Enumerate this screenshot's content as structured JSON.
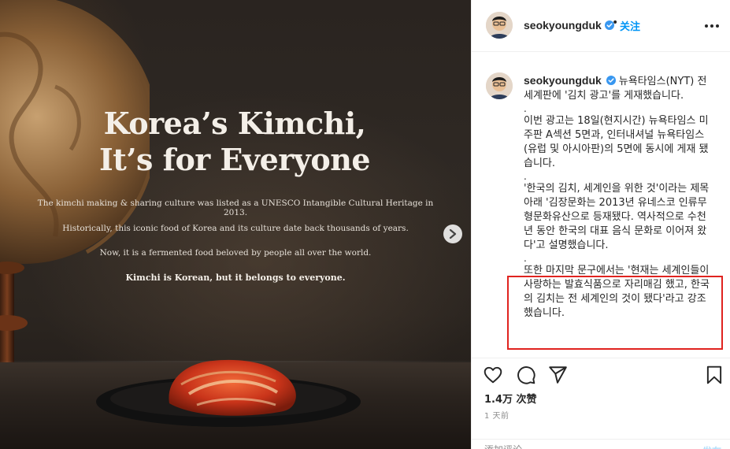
{
  "ad": {
    "headline_line1": "Korea’s Kimchi,",
    "headline_line2": "It’s for Everyone",
    "body_line1": "The kimchi making & sharing culture was listed as a UNESCO Intangible Cultural Heritage in 2013.",
    "body_line2": "Historically, this iconic food of Korea and its culture date back thousands of years.",
    "body_line3": "Now, it is a fermented food beloved by people all over the world.",
    "body_line4": "Kimchi is Korean, but it belongs to everyone."
  },
  "header": {
    "username": "seokyoungduk",
    "separator": "•",
    "follow_label": "关注"
  },
  "caption": {
    "username": "seokyoungduk",
    "p1": "뉴욕타임스(NYT) 전 세계판에 '김치 광고'를 게재했습니다.",
    "dot1": ".",
    "p2": "이번 광고는 18일(현지시간) 뉴욕타임스 미주판 A섹션 5면과, 인터내셔널 뉴욕타임스(유럽 및 아시아판)의 5면에 동시에 게재 됐습니다.",
    "dot2": ".",
    "p3": "'한국의 김치, 세계인을 위한 것'이라는 제목 아래 '김장문화는 2013년 유네스코 인류무형문화유산으로 등재됐다. 역사적으로 수천년 동안 한국의 대표 음식 문화로 이어져 왔다'고 설명했습니다.",
    "dot3": ".",
    "p4": "또한 마지막 문구에서는 '현재는 세계인들이 사랑하는 발효식품으로 자리매김 했고, 한국의 김치는 전 세계인의 것이 됐다'라고 강조했습니다."
  },
  "stats": {
    "likes": "1.4万 次赞",
    "time_ago": "1 天前"
  },
  "comment": {
    "placeholder": "添加评论……",
    "post_label": "发布"
  },
  "colors": {
    "accent": "#0095f6",
    "highlight_box": "#e0231f",
    "verified": "#3897f0"
  },
  "icons": [
    "verified-badge-icon",
    "more-options-icon",
    "heart-icon",
    "comment-icon",
    "share-icon",
    "bookmark-icon",
    "chevron-right-icon"
  ]
}
